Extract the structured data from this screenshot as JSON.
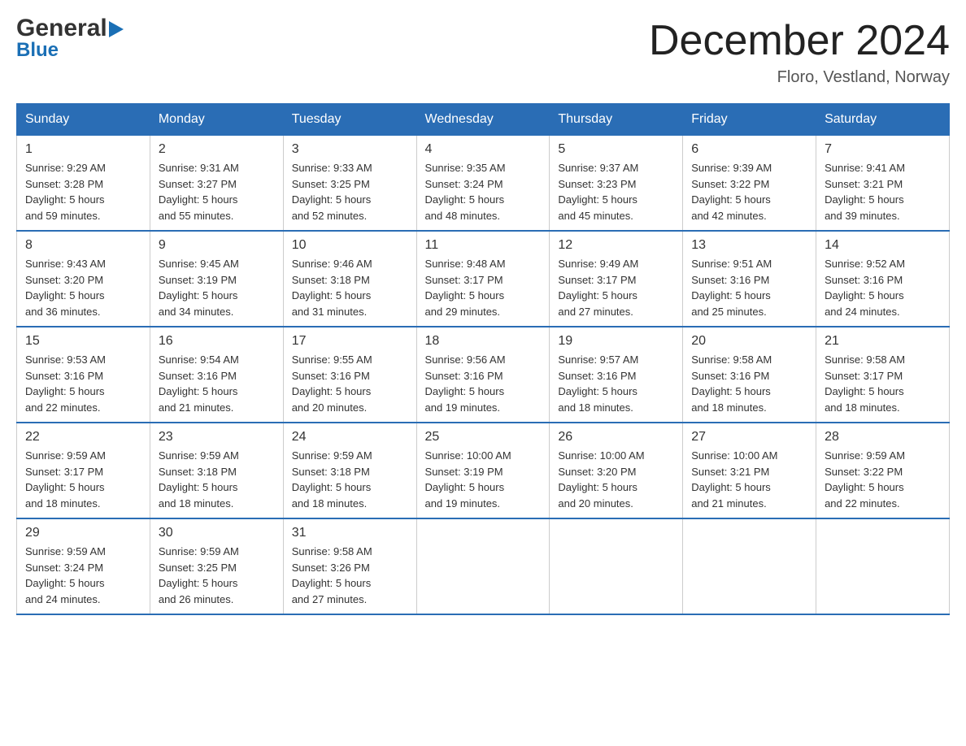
{
  "header": {
    "logo_general": "General",
    "logo_blue": "Blue",
    "month_title": "December 2024",
    "location": "Floro, Vestland, Norway"
  },
  "days_of_week": [
    "Sunday",
    "Monday",
    "Tuesday",
    "Wednesday",
    "Thursday",
    "Friday",
    "Saturday"
  ],
  "weeks": [
    [
      {
        "day": "1",
        "sunrise": "9:29 AM",
        "sunset": "3:28 PM",
        "daylight": "5 hours and 59 minutes."
      },
      {
        "day": "2",
        "sunrise": "9:31 AM",
        "sunset": "3:27 PM",
        "daylight": "5 hours and 55 minutes."
      },
      {
        "day": "3",
        "sunrise": "9:33 AM",
        "sunset": "3:25 PM",
        "daylight": "5 hours and 52 minutes."
      },
      {
        "day": "4",
        "sunrise": "9:35 AM",
        "sunset": "3:24 PM",
        "daylight": "5 hours and 48 minutes."
      },
      {
        "day": "5",
        "sunrise": "9:37 AM",
        "sunset": "3:23 PM",
        "daylight": "5 hours and 45 minutes."
      },
      {
        "day": "6",
        "sunrise": "9:39 AM",
        "sunset": "3:22 PM",
        "daylight": "5 hours and 42 minutes."
      },
      {
        "day": "7",
        "sunrise": "9:41 AM",
        "sunset": "3:21 PM",
        "daylight": "5 hours and 39 minutes."
      }
    ],
    [
      {
        "day": "8",
        "sunrise": "9:43 AM",
        "sunset": "3:20 PM",
        "daylight": "5 hours and 36 minutes."
      },
      {
        "day": "9",
        "sunrise": "9:45 AM",
        "sunset": "3:19 PM",
        "daylight": "5 hours and 34 minutes."
      },
      {
        "day": "10",
        "sunrise": "9:46 AM",
        "sunset": "3:18 PM",
        "daylight": "5 hours and 31 minutes."
      },
      {
        "day": "11",
        "sunrise": "9:48 AM",
        "sunset": "3:17 PM",
        "daylight": "5 hours and 29 minutes."
      },
      {
        "day": "12",
        "sunrise": "9:49 AM",
        "sunset": "3:17 PM",
        "daylight": "5 hours and 27 minutes."
      },
      {
        "day": "13",
        "sunrise": "9:51 AM",
        "sunset": "3:16 PM",
        "daylight": "5 hours and 25 minutes."
      },
      {
        "day": "14",
        "sunrise": "9:52 AM",
        "sunset": "3:16 PM",
        "daylight": "5 hours and 24 minutes."
      }
    ],
    [
      {
        "day": "15",
        "sunrise": "9:53 AM",
        "sunset": "3:16 PM",
        "daylight": "5 hours and 22 minutes."
      },
      {
        "day": "16",
        "sunrise": "9:54 AM",
        "sunset": "3:16 PM",
        "daylight": "5 hours and 21 minutes."
      },
      {
        "day": "17",
        "sunrise": "9:55 AM",
        "sunset": "3:16 PM",
        "daylight": "5 hours and 20 minutes."
      },
      {
        "day": "18",
        "sunrise": "9:56 AM",
        "sunset": "3:16 PM",
        "daylight": "5 hours and 19 minutes."
      },
      {
        "day": "19",
        "sunrise": "9:57 AM",
        "sunset": "3:16 PM",
        "daylight": "5 hours and 18 minutes."
      },
      {
        "day": "20",
        "sunrise": "9:58 AM",
        "sunset": "3:16 PM",
        "daylight": "5 hours and 18 minutes."
      },
      {
        "day": "21",
        "sunrise": "9:58 AM",
        "sunset": "3:17 PM",
        "daylight": "5 hours and 18 minutes."
      }
    ],
    [
      {
        "day": "22",
        "sunrise": "9:59 AM",
        "sunset": "3:17 PM",
        "daylight": "5 hours and 18 minutes."
      },
      {
        "day": "23",
        "sunrise": "9:59 AM",
        "sunset": "3:18 PM",
        "daylight": "5 hours and 18 minutes."
      },
      {
        "day": "24",
        "sunrise": "9:59 AM",
        "sunset": "3:18 PM",
        "daylight": "5 hours and 18 minutes."
      },
      {
        "day": "25",
        "sunrise": "10:00 AM",
        "sunset": "3:19 PM",
        "daylight": "5 hours and 19 minutes."
      },
      {
        "day": "26",
        "sunrise": "10:00 AM",
        "sunset": "3:20 PM",
        "daylight": "5 hours and 20 minutes."
      },
      {
        "day": "27",
        "sunrise": "10:00 AM",
        "sunset": "3:21 PM",
        "daylight": "5 hours and 21 minutes."
      },
      {
        "day": "28",
        "sunrise": "9:59 AM",
        "sunset": "3:22 PM",
        "daylight": "5 hours and 22 minutes."
      }
    ],
    [
      {
        "day": "29",
        "sunrise": "9:59 AM",
        "sunset": "3:24 PM",
        "daylight": "5 hours and 24 minutes."
      },
      {
        "day": "30",
        "sunrise": "9:59 AM",
        "sunset": "3:25 PM",
        "daylight": "5 hours and 26 minutes."
      },
      {
        "day": "31",
        "sunrise": "9:58 AM",
        "sunset": "3:26 PM",
        "daylight": "5 hours and 27 minutes."
      },
      null,
      null,
      null,
      null
    ]
  ],
  "labels": {
    "sunrise": "Sunrise:",
    "sunset": "Sunset:",
    "daylight": "Daylight:"
  }
}
